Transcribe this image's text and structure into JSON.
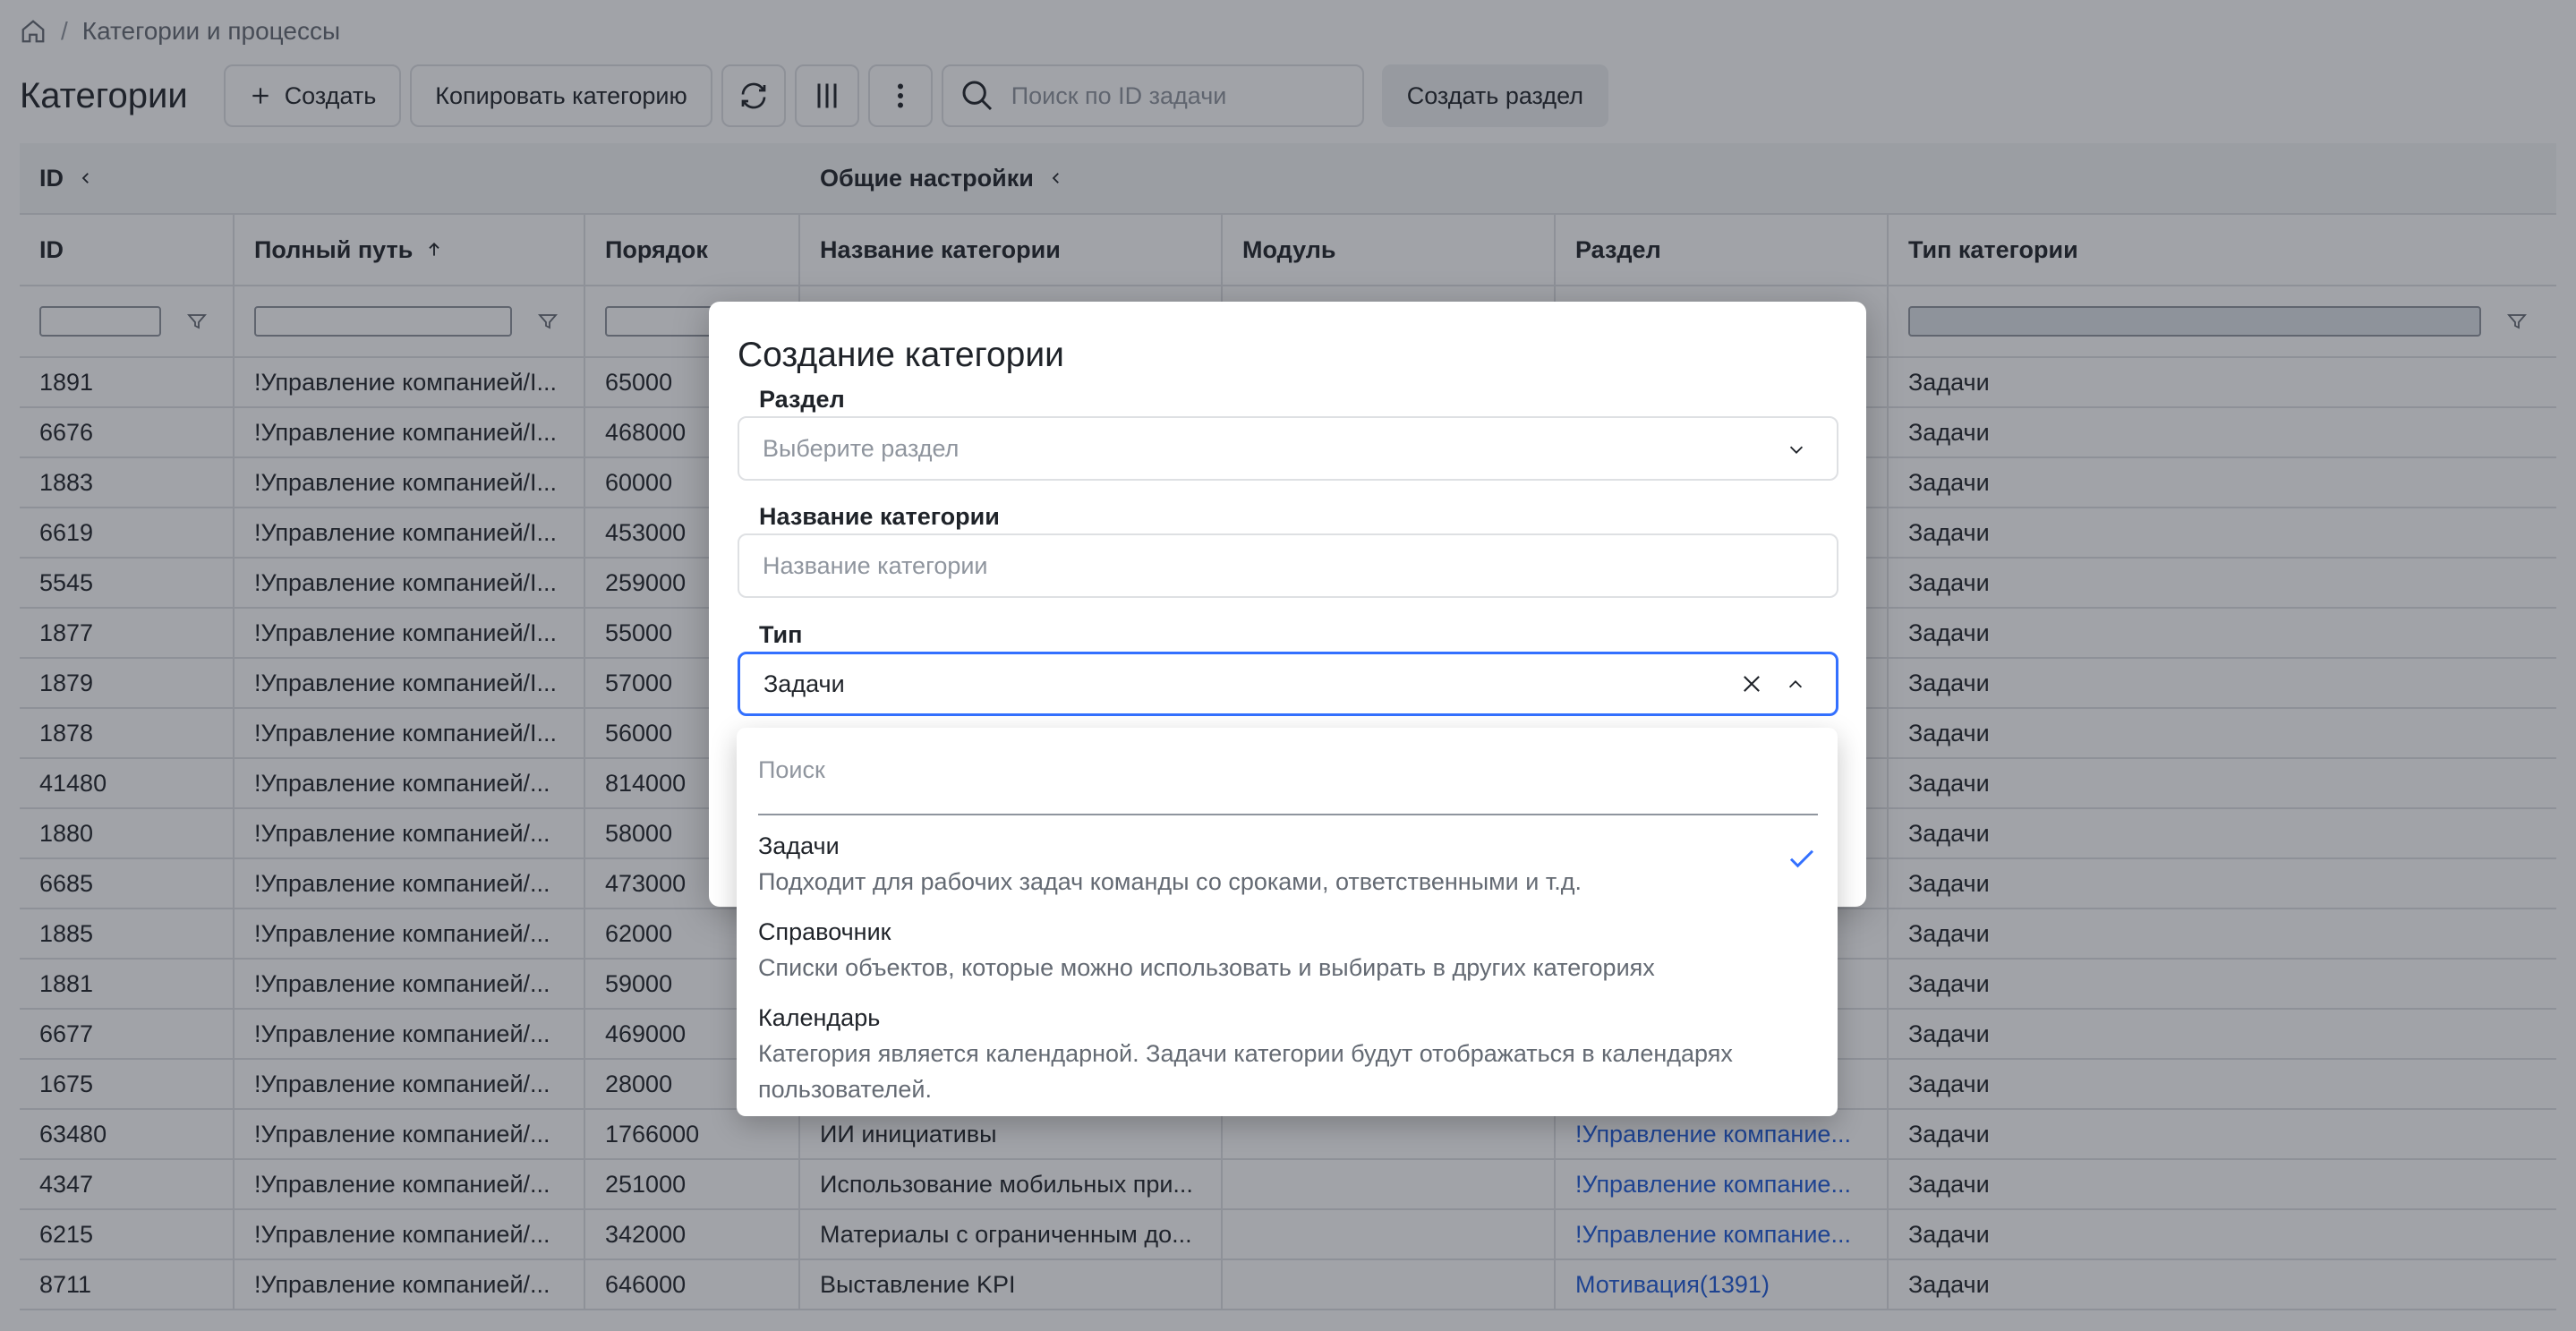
{
  "breadcrumb": {
    "current": "Категории и процессы"
  },
  "toolbar": {
    "title": "Категории",
    "create_label": "Создать",
    "copy_label": "Копировать категорию",
    "search_placeholder": "Поиск по ID задачи",
    "create_section_label": "Создать раздел"
  },
  "grid": {
    "groups": [
      "ID",
      "Общие настройки"
    ],
    "columns": [
      "ID",
      "Полный путь",
      "Порядок",
      "Название категории",
      "Модуль",
      "Раздел",
      "Тип категории"
    ],
    "rows": [
      {
        "id": "1891",
        "path": "!Управление компанией/I...",
        "order": "65000",
        "name": "",
        "module": "",
        "section": "",
        "type": "Задачи"
      },
      {
        "id": "6676",
        "path": "!Управление компанией/I...",
        "order": "468000",
        "name": "",
        "module": "",
        "section": "",
        "type": "Задачи"
      },
      {
        "id": "1883",
        "path": "!Управление компанией/I...",
        "order": "60000",
        "name": "",
        "module": "",
        "section": "",
        "type": "Задачи"
      },
      {
        "id": "6619",
        "path": "!Управление компанией/I...",
        "order": "453000",
        "name": "",
        "module": "",
        "section": "",
        "type": "Задачи"
      },
      {
        "id": "5545",
        "path": "!Управление компанией/I...",
        "order": "259000",
        "name": "",
        "module": "",
        "section": "",
        "type": "Задачи"
      },
      {
        "id": "1877",
        "path": "!Управление компанией/I...",
        "order": "55000",
        "name": "",
        "module": "",
        "section": "",
        "type": "Задачи"
      },
      {
        "id": "1879",
        "path": "!Управление компанией/I...",
        "order": "57000",
        "name": "",
        "module": "",
        "section": "",
        "type": "Задачи"
      },
      {
        "id": "1878",
        "path": "!Управление компанией/I...",
        "order": "56000",
        "name": "",
        "module": "",
        "section": "",
        "type": "Задачи"
      },
      {
        "id": "41480",
        "path": "!Управление компанией/...",
        "order": "814000",
        "name": "",
        "module": "",
        "section": "",
        "type": "Задачи"
      },
      {
        "id": "1880",
        "path": "!Управление компанией/...",
        "order": "58000",
        "name": "",
        "module": "",
        "section": "",
        "type": "Задачи"
      },
      {
        "id": "6685",
        "path": "!Управление компанией/...",
        "order": "473000",
        "name": "",
        "module": "",
        "section": "",
        "type": "Задачи"
      },
      {
        "id": "1885",
        "path": "!Управление компанией/...",
        "order": "62000",
        "name": "",
        "module": "",
        "section": "",
        "type": "Задачи"
      },
      {
        "id": "1881",
        "path": "!Управление компанией/...",
        "order": "59000",
        "name": "",
        "module": "",
        "section": "",
        "type": "Задачи"
      },
      {
        "id": "6677",
        "path": "!Управление компанией/...",
        "order": "469000",
        "name": "",
        "module": "",
        "section": "",
        "type": "Задачи"
      },
      {
        "id": "1675",
        "path": "!Управление компанией/...",
        "order": "28000",
        "name": "",
        "module": "",
        "section": "",
        "type": "Задачи"
      },
      {
        "id": "63480",
        "path": "!Управление компанией/...",
        "order": "1766000",
        "name": "ИИ инициативы",
        "module": "",
        "section": "!Управление компание...",
        "type": "Задачи"
      },
      {
        "id": "4347",
        "path": "!Управление компанией/...",
        "order": "251000",
        "name": "Использование мобильных при...",
        "module": "",
        "section": "!Управление компание...",
        "type": "Задачи"
      },
      {
        "id": "6215",
        "path": "!Управление компанией/...",
        "order": "342000",
        "name": "Материалы с ограниченным до...",
        "module": "",
        "section": "!Управление компание...",
        "type": "Задачи"
      },
      {
        "id": "8711",
        "path": "!Управление компанией/...",
        "order": "646000",
        "name": "Выставление KPI",
        "module": "",
        "section": "Мотивация(1391)",
        "type": "Задачи"
      }
    ]
  },
  "modal": {
    "title": "Создание категории",
    "section_label": "Раздел",
    "section_placeholder": "Выберите раздел",
    "name_label": "Название категории",
    "name_placeholder": "Название категории",
    "type_label": "Тип",
    "type_value": "Задачи"
  },
  "dropdown": {
    "search_placeholder": "Поиск",
    "options": [
      {
        "title": "Задачи",
        "desc": "Подходит для рабочих задач команды со сроками, ответственными и т.д.",
        "selected": true
      },
      {
        "title": "Справочник",
        "desc": "Списки объектов, которые можно использовать и выбирать в других категориях",
        "selected": false
      },
      {
        "title": "Календарь",
        "desc": "Категория является календарной. Задачи категории будут отображаться в календарях пользователей.",
        "selected": false
      }
    ]
  },
  "colors": {
    "accent": "#3370ff",
    "link": "#1e5bd8",
    "overlay": "rgba(30,36,48,0.42)"
  }
}
